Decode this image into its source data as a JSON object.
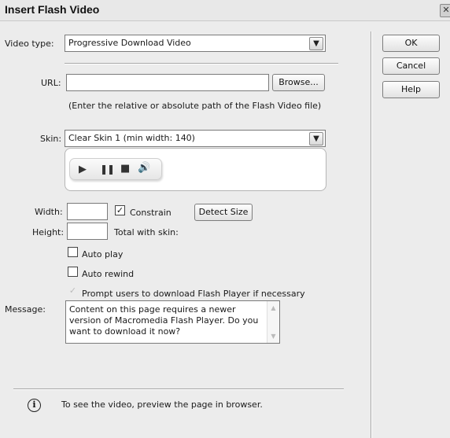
{
  "window": {
    "title": "Insert Flash Video",
    "close_glyph": "✕"
  },
  "video_type": {
    "label": "Video type:",
    "value": "Progressive Download Video"
  },
  "url": {
    "label": "URL:",
    "value": "",
    "browse_label": "Browse...",
    "hint": "(Enter the relative or absolute path of the Flash Video file)"
  },
  "skin": {
    "label": "Skin:",
    "value": "Clear Skin 1 (min width: 140)",
    "controls": [
      "play-icon",
      "pause-icon",
      "stop-icon",
      "speaker-icon"
    ]
  },
  "size": {
    "width_label": "Width:",
    "width_value": "",
    "constrain_label": "Constrain",
    "constrain_checked": true,
    "detect_label": "Detect Size",
    "height_label": "Height:",
    "height_value": "",
    "total_label": "Total with skin:"
  },
  "options": {
    "auto_play_label": "Auto play",
    "auto_play_checked": false,
    "auto_rewind_label": "Auto rewind",
    "auto_rewind_checked": false,
    "prompt_label": "Prompt users to download Flash Player if necessary",
    "prompt_checked": true
  },
  "message": {
    "label": "Message:",
    "value": "Content on this page requires a newer version of Macromedia Flash Player. Do you want to download it now?"
  },
  "buttons": {
    "ok": "OK",
    "cancel": "Cancel",
    "help": "Help"
  },
  "footer": {
    "icon": "info-icon",
    "text": "To see the video, preview the page in browser."
  },
  "colors": {
    "dialog_bg": "#ececec",
    "border": "#7a7a7a"
  }
}
